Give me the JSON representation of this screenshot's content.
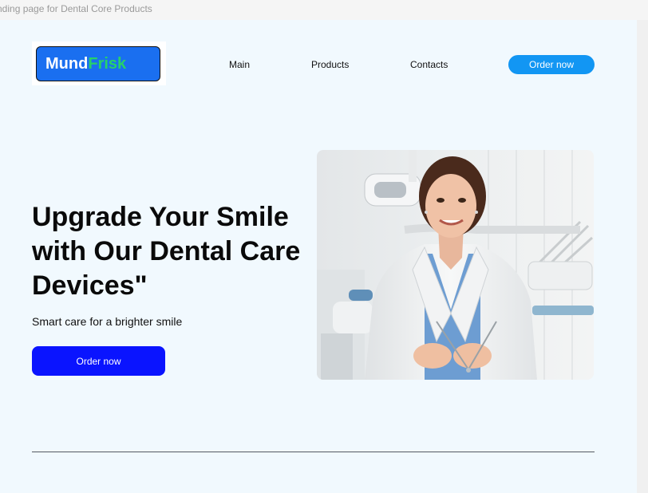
{
  "frame_label": "nding page for Dental Core Products",
  "logo": {
    "part1": "Mund",
    "part2": "Frisk",
    "color1": "#ffffff",
    "color2": "#27d16a",
    "background": "#1a6ff0"
  },
  "nav": [
    {
      "label": "Main"
    },
    {
      "label": "Products"
    },
    {
      "label": "Contacts"
    }
  ],
  "header": {
    "order_button": "Order now",
    "order_button_color": "#1296f3"
  },
  "hero": {
    "title": "Upgrade Your Smile with Our Dental Care Devices\"",
    "subtitle": "Smart care for a brighter smile",
    "order_button": "Order now",
    "order_button_color": "#0a14ff",
    "image": "dentist-photo"
  },
  "colors": {
    "page_background": "#f1f9fe"
  }
}
